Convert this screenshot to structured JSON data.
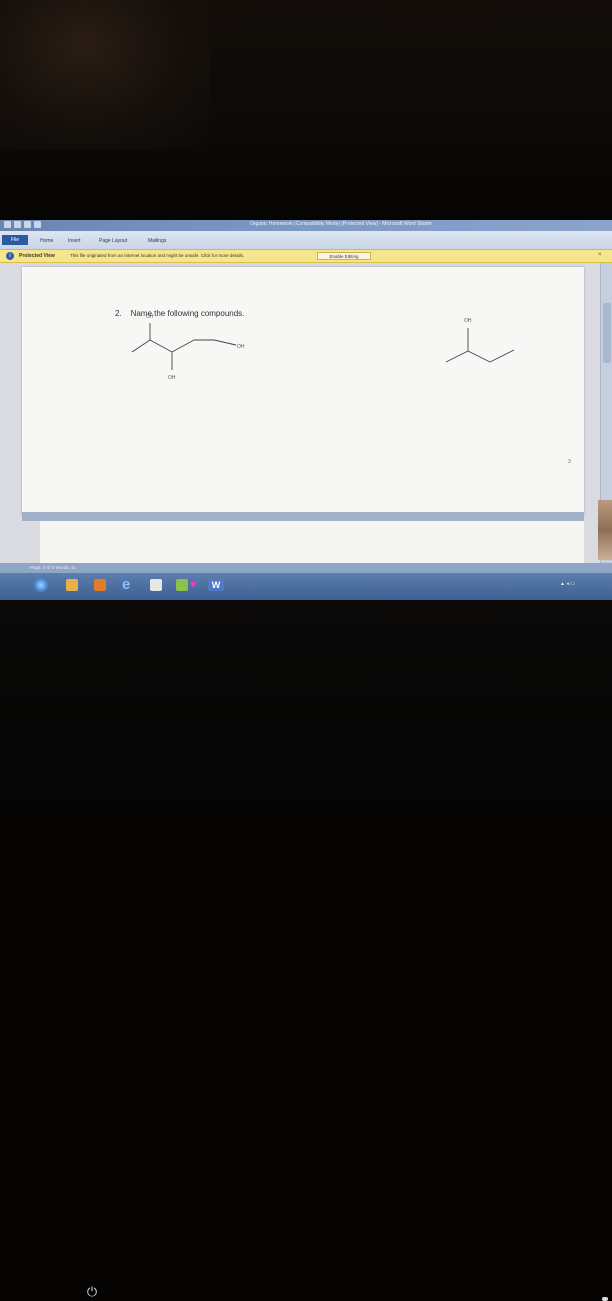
{
  "window": {
    "title": "Organic Homework (Compatibility Mode) [Protected View] - Microsoft Word Starter"
  },
  "ribbon": {
    "tabs": [
      {
        "label": "File"
      },
      {
        "label": "Home"
      },
      {
        "label": "Insert"
      },
      {
        "label": "Page Layout"
      },
      {
        "label": "Mailings"
      }
    ]
  },
  "protected_view": {
    "label": "Protected View",
    "message": "This file originated from an Internet location and might be unsafe. Click for more details.",
    "enable_button": "Enable Editing"
  },
  "document": {
    "question_number": "2.",
    "question_text": "Name the following compounds.",
    "molecule1_labels": [
      "OH",
      "OH",
      "OH"
    ],
    "molecule2_labels": [
      "OH"
    ],
    "page_number": "3"
  },
  "statusbar": {
    "text": "Page: 3 of 3   Words: 41"
  },
  "taskbar": {
    "word_label": "W"
  },
  "colors": {
    "protected_bar": "#f6e58a",
    "title_bar": "#7c98c4",
    "taskbar": "#3f5f92"
  }
}
